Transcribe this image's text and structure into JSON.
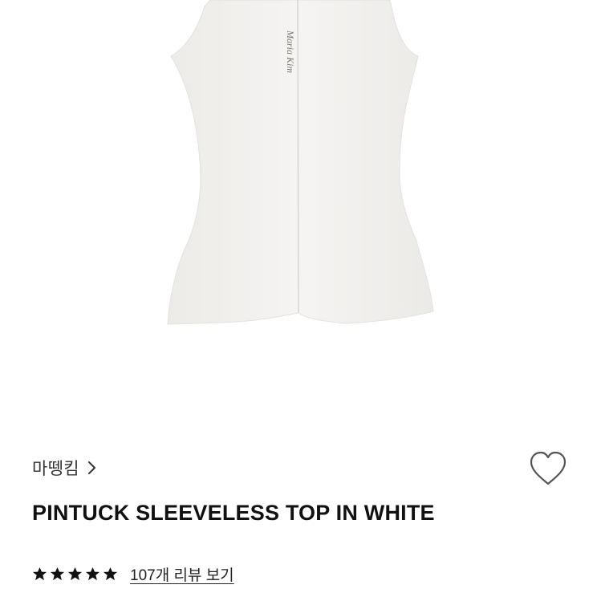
{
  "product": {
    "image_label": "Maria Kim",
    "brand": "마뗑킴",
    "title": "PINTUCK SLEEVELESS TOP IN WHITE",
    "rating_stars": 5,
    "review_link": "107개 리뷰 보기"
  },
  "icons": {
    "brand_chevron": "chevron-right-icon",
    "wishlist": "heart-outline-icon",
    "rating": "star-filled-icon"
  },
  "colors": {
    "text": "#111111",
    "garment": "#f3f1ee",
    "icon_outline": "#555555"
  }
}
